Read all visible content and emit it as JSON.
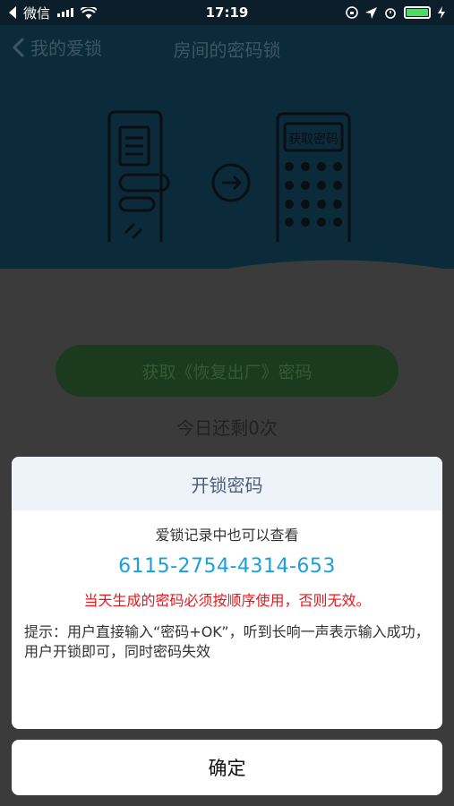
{
  "status_bar": {
    "carrier": "微信",
    "time": "17:19",
    "battery_level": 1.0
  },
  "nav": {
    "back_label": "我的爱锁",
    "title": "房间的密码锁"
  },
  "illustration": {
    "keypad_label": "获取密码"
  },
  "main": {
    "get_reset_button": "获取《恢复出厂》密码",
    "remaining_text": "今日还剩0次"
  },
  "dialog": {
    "title": "开锁密码",
    "subtitle": "爱锁记录中也可以查看",
    "code": "6115-2754-4314-653",
    "warning": "当天生成的密码必须按顺序使用，否则无效。",
    "tip": "提示：用户直接输入“密码+OK”，听到长响一声表示输入成功，用户开锁即可，同时密码失效",
    "confirm": "确定"
  },
  "colors": {
    "hero_bg": "#0b2a3a",
    "code_blue": "#1aa0dc",
    "warning_red": "#e8161b",
    "button_green": "#1c3a1e"
  }
}
